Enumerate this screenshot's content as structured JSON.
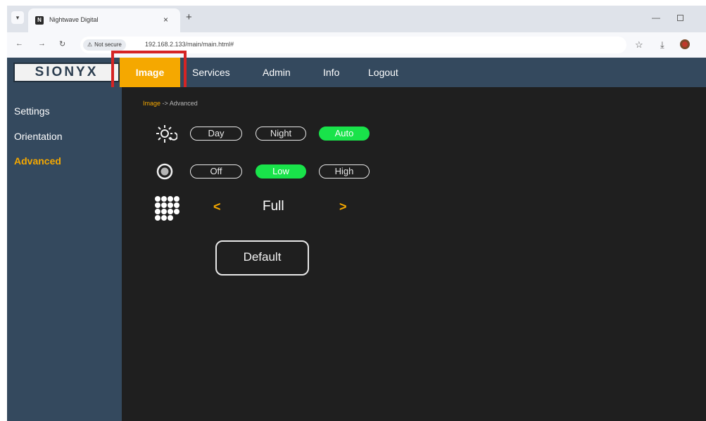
{
  "browser": {
    "tab_title": "Nightwave Digital",
    "tab_close": "×",
    "new_tab": "+",
    "not_secure": "Not secure",
    "url": "192.168.2.133/main/main.html#",
    "icons": [
      "tab-menu-icon",
      "back-arrow-icon",
      "forward-arrow-icon",
      "reload-icon",
      "warning-icon",
      "star-icon",
      "download-icon",
      "profile-icon",
      "minimize-icon",
      "maximize-icon"
    ]
  },
  "header": {
    "logo": "SIONYX",
    "nav": [
      {
        "label": "Image",
        "active": true
      },
      {
        "label": "Services",
        "active": false
      },
      {
        "label": "Admin",
        "active": false
      },
      {
        "label": "Info",
        "active": false
      },
      {
        "label": "Logout",
        "active": false
      }
    ]
  },
  "sidebar": {
    "items": [
      {
        "label": "Settings",
        "active": false
      },
      {
        "label": "Orientation",
        "active": false
      },
      {
        "label": "Advanced",
        "active": true
      }
    ]
  },
  "breadcrumb": {
    "current": "Image",
    "separator": " -> ",
    "last": "Advanced"
  },
  "advanced": {
    "mode": {
      "icon": "day-night-icon",
      "options": [
        {
          "label": "Day",
          "selected": false
        },
        {
          "label": "Night",
          "selected": false
        },
        {
          "label": "Auto",
          "selected": true
        }
      ]
    },
    "level": {
      "icon": "sensor-circle-icon",
      "options": [
        {
          "label": "Off",
          "selected": false
        },
        {
          "label": "Low",
          "selected": true
        },
        {
          "label": "High",
          "selected": false
        }
      ]
    },
    "resolution": {
      "icon": "grid-icon",
      "prev": "<",
      "value": "Full",
      "next": ">"
    },
    "default_label": "Default"
  },
  "colors": {
    "accent": "#f5a800",
    "selected": "#19e34a",
    "header_bg": "#34495e",
    "panel_bg": "#1f1f1f",
    "highlight": "#d62424"
  }
}
